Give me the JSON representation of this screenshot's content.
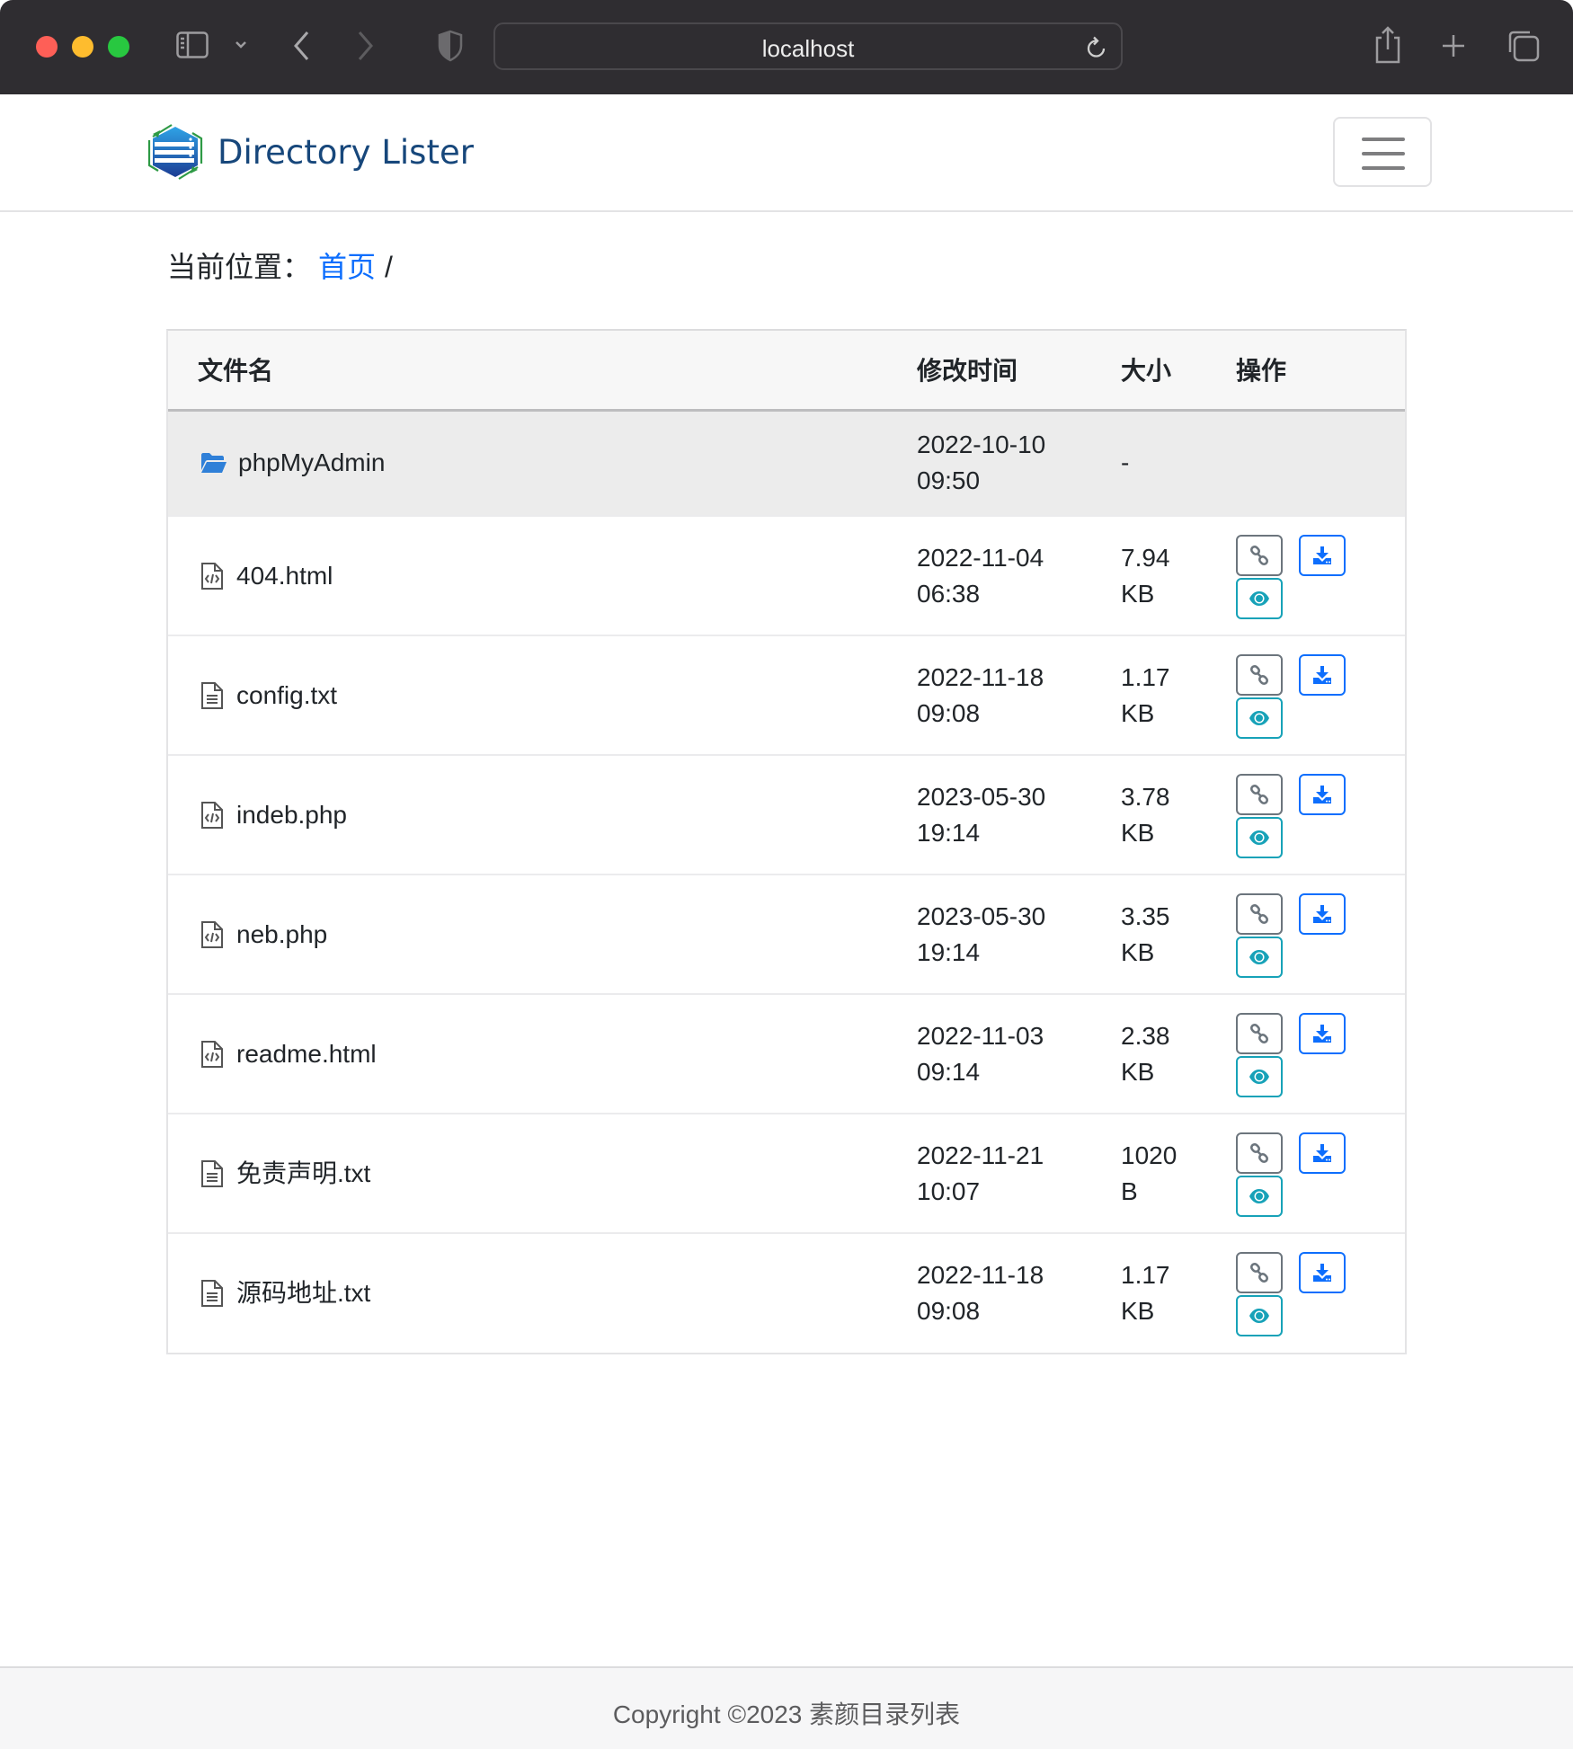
{
  "browser": {
    "url": "localhost"
  },
  "navbar": {
    "brand": "Directory Lister"
  },
  "breadcrumb": {
    "label": "当前位置：",
    "home": "首页",
    "separator": "/"
  },
  "table": {
    "headers": {
      "name": "文件名",
      "time": "修改时间",
      "size": "大小",
      "ops": "操作"
    },
    "folder": {
      "name": "phpMyAdmin",
      "date": "2022-10-10",
      "time": "09:50",
      "size": "-",
      "icon": "folder-open-icon"
    },
    "rows": [
      {
        "name": "404.html",
        "date": "2022-11-04",
        "time": "06:38",
        "size_value": "7.94",
        "size_unit": "KB",
        "icon": "file-code-icon"
      },
      {
        "name": "config.txt",
        "date": "2022-11-18",
        "time": "09:08",
        "size_value": "1.17",
        "size_unit": "KB",
        "icon": "file-text-icon"
      },
      {
        "name": "indeb.php",
        "date": "2023-05-30",
        "time": "19:14",
        "size_value": "3.78",
        "size_unit": "KB",
        "icon": "file-code-icon"
      },
      {
        "name": "neb.php",
        "date": "2023-05-30",
        "time": "19:14",
        "size_value": "3.35",
        "size_unit": "KB",
        "icon": "file-code-icon"
      },
      {
        "name": "readme.html",
        "date": "2022-11-03",
        "time": "09:14",
        "size_value": "2.38",
        "size_unit": "KB",
        "icon": "file-code-icon"
      },
      {
        "name": "免责声明.txt",
        "date": "2022-11-21",
        "time": "10:07",
        "size_value": "1020",
        "size_unit": "B",
        "icon": "file-text-icon"
      },
      {
        "name": "源码地址.txt",
        "date": "2022-11-18",
        "time": "09:08",
        "size_value": "1.17",
        "size_unit": "KB",
        "icon": "file-text-icon"
      }
    ],
    "actions": {
      "copy_link": "link-icon",
      "download": "download-icon",
      "preview": "eye-icon"
    }
  },
  "colors": {
    "link_blue": "#0d6efd",
    "secondary_gray": "#6c757d",
    "info_teal": "#17a2b8",
    "brand_navy": "#17477b",
    "folder_blue": "#2f80d8"
  },
  "footer": {
    "copyright": "Copyright ©2023 素颜目录列表"
  }
}
